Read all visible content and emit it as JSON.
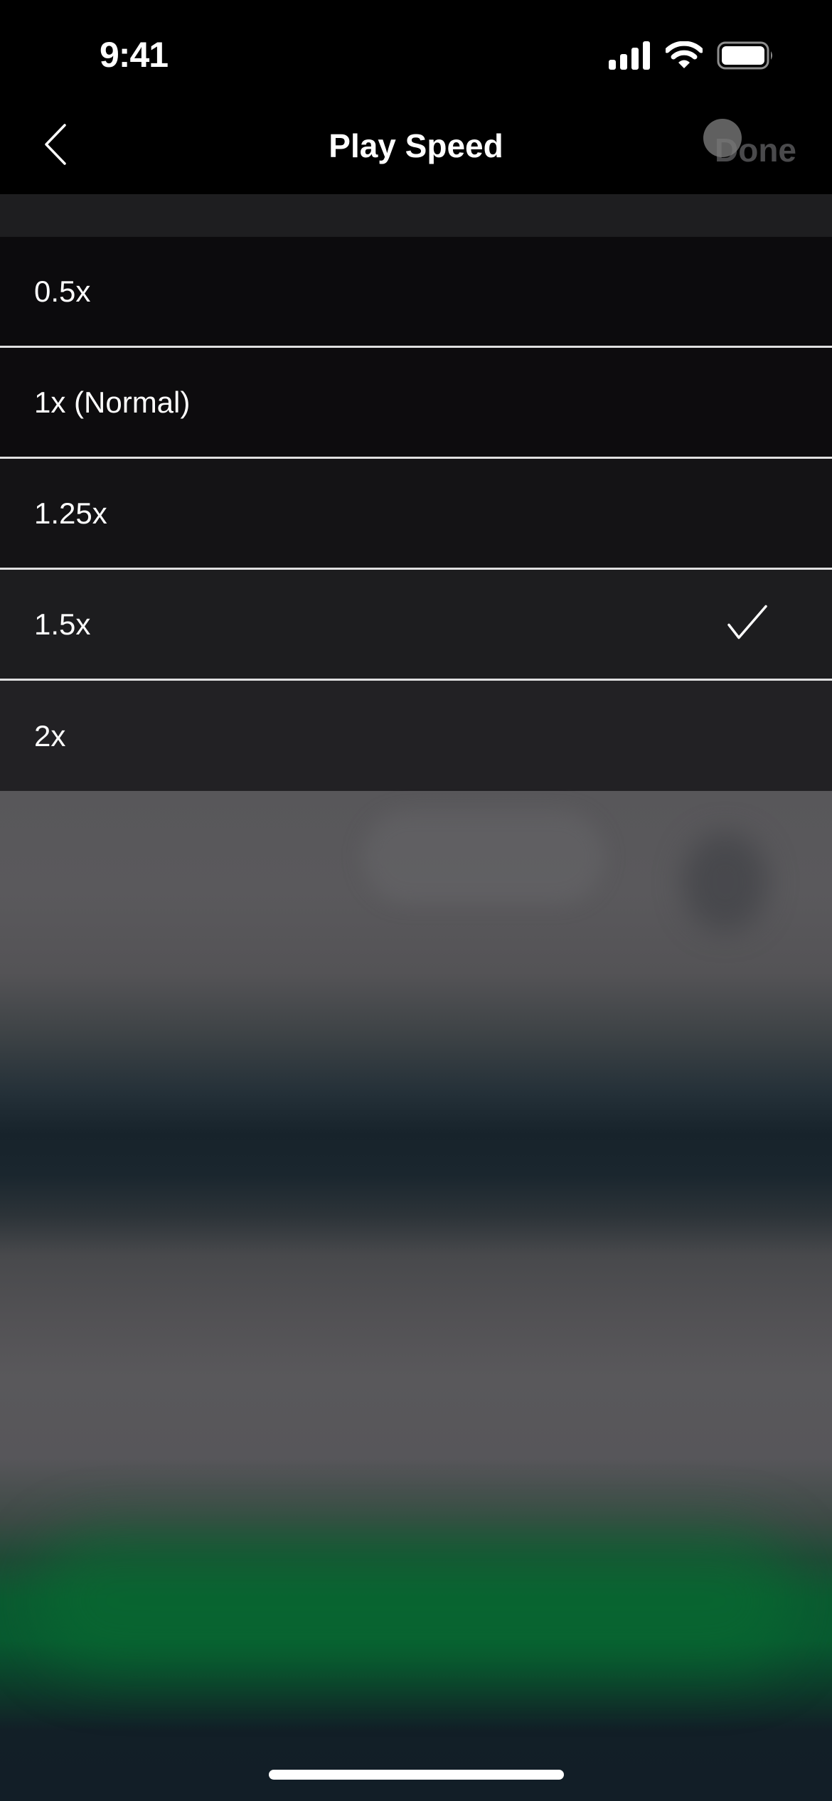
{
  "status_bar": {
    "time": "9:41",
    "icons": [
      "cellular-signal-icon",
      "wifi-icon",
      "battery-icon"
    ]
  },
  "nav": {
    "back_icon": "chevron-left-icon",
    "title": "Play Speed",
    "done_label": "Done",
    "done_enabled": false
  },
  "speed_options": {
    "items": [
      {
        "label": "0.5x",
        "selected": false
      },
      {
        "label": "1x (Normal)",
        "selected": false
      },
      {
        "label": "1.25x",
        "selected": false
      },
      {
        "label": "1.5x",
        "selected": true
      },
      {
        "label": "2x",
        "selected": false
      }
    ],
    "selected_icon": "checkmark-icon"
  },
  "colors": {
    "background": "#000000",
    "text": "#ffffff",
    "done_disabled": "#4a4a4c",
    "divider": "#e0e0e0",
    "accent_green": "#085a30"
  }
}
